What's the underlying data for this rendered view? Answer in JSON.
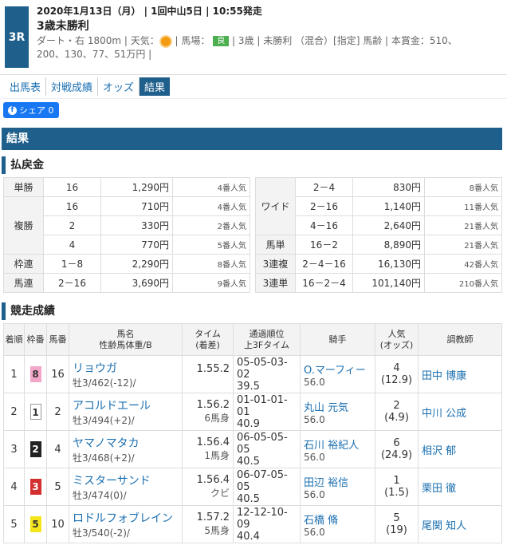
{
  "race": {
    "number": "3R",
    "date": "2020年1月13日（月） | 1回中山5日 | 10:55発走",
    "name": "3歳未勝利",
    "cond1": "ダート・右 1800m | 天気：",
    "cond2": " | 馬場：",
    "baba": "良",
    "cond3": " | 3歳 | 未勝利 （混合）[指定] 馬齢 | 本賞金：510、",
    "cond4": "200、130、77、51万円 |"
  },
  "tabs": [
    "出馬表",
    "対戦成績",
    "オッズ",
    "結果"
  ],
  "share": {
    "label": "シェア 0",
    "icon": "f"
  },
  "section_result": "結果",
  "section_payout": "払戻金",
  "section_race": "競走成績",
  "payout_left": [
    {
      "label": "単勝",
      "num": "16",
      "yen": "1,290円",
      "pop": "4番人気"
    },
    {
      "label": "複勝",
      "num": "16",
      "yen": "710円",
      "pop": "4番人気"
    },
    {
      "label": "",
      "num": "2",
      "yen": "330円",
      "pop": "2番人気"
    },
    {
      "label": "",
      "num": "4",
      "yen": "770円",
      "pop": "5番人気"
    },
    {
      "label": "枠連",
      "num": "1－8",
      "yen": "2,290円",
      "pop": "8番人気"
    },
    {
      "label": "馬連",
      "num": "2－16",
      "yen": "3,690円",
      "pop": "9番人気"
    }
  ],
  "payout_right": [
    {
      "label": "ワイド",
      "num": "2－4",
      "yen": "830円",
      "pop": "8番人気"
    },
    {
      "label": "",
      "num": "2－16",
      "yen": "1,140円",
      "pop": "11番人気"
    },
    {
      "label": "",
      "num": "4－16",
      "yen": "2,640円",
      "pop": "21番人気"
    },
    {
      "label": "馬単",
      "num": "16－2",
      "yen": "8,890円",
      "pop": "21番人気"
    },
    {
      "label": "3連複",
      "num": "2－4－16",
      "yen": "16,130円",
      "pop": "42番人気"
    },
    {
      "label": "3連単",
      "num": "16－2－4",
      "yen": "101,140円",
      "pop": "210番人気"
    }
  ],
  "headers": {
    "rank": "着順",
    "waku": "枠番",
    "umaban": "馬番",
    "horse": "馬名",
    "horse_sub": "性齢馬体重/B",
    "time": "タイム",
    "time_sub": "(着差)",
    "pass": "通過順位",
    "pass_sub": "上3Fタイム",
    "jockey": "騎手",
    "pop": "人気",
    "pop_sub": "(オッズ)",
    "trainer": "調教師"
  },
  "rows": [
    {
      "rank": "1",
      "waku": "8",
      "waku_bg": "#f4a6c8",
      "waku_fg": "#333",
      "umaban": "16",
      "horse": "リョウガ",
      "info": "牡3/462(-12)/",
      "time": "1.55.2",
      "margin": "",
      "pass": "05-05-03-02",
      "f3": "39.5",
      "jockey": "O.マーフィー",
      "weight": "56.0",
      "pop": "4",
      "odds": "(12.9)",
      "trainer": "田中 博康"
    },
    {
      "rank": "2",
      "waku": "1",
      "waku_bg": "#ffffff",
      "waku_fg": "#333",
      "umaban": "2",
      "horse": "アコルドエール",
      "info": "牡3/494(+2)/",
      "time": "1.56.2",
      "margin": "6馬身",
      "pass": "01-01-01-01",
      "f3": "40.9",
      "jockey": "丸山 元気",
      "weight": "56.0",
      "pop": "2",
      "odds": "(4.9)",
      "trainer": "中川 公成"
    },
    {
      "rank": "3",
      "waku": "2",
      "waku_bg": "#222222",
      "waku_fg": "#fff",
      "umaban": "4",
      "horse": "ヤマノマタカ",
      "info": "牡3/468(+2)/",
      "time": "1.56.4",
      "margin": "1馬身",
      "pass": "06-05-05-05",
      "f3": "40.5",
      "jockey": "石川 裕紀人",
      "weight": "56.0",
      "pop": "6",
      "odds": "(24.9)",
      "trainer": "相沢 郁"
    },
    {
      "rank": "4",
      "waku": "3",
      "waku_bg": "#d32f2f",
      "waku_fg": "#fff",
      "umaban": "5",
      "horse": "ミスターサンド",
      "info": "牡3/474(0)/",
      "time": "1.56.4",
      "margin": "クビ",
      "pass": "06-07-05-05",
      "f3": "40.5",
      "jockey": "田辺 裕信",
      "weight": "56.0",
      "pop": "1",
      "odds": "(1.5)",
      "trainer": "栗田 徹"
    },
    {
      "rank": "5",
      "waku": "5",
      "waku_bg": "#f5e51b",
      "waku_fg": "#333",
      "umaban": "10",
      "horse": "ロドルフォブレイン",
      "info": "牡3/540(-2)/",
      "time": "1.57.2",
      "margin": "5馬身",
      "pass": "12-12-10-09",
      "f3": "40.4",
      "jockey": "石橋 脩",
      "weight": "56.0",
      "pop": "5",
      "odds": "(19)",
      "trainer": "尾関 知人"
    }
  ]
}
